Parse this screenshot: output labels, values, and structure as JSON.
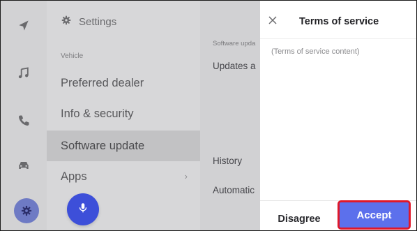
{
  "rail": {
    "icons": [
      "navigation-icon",
      "music-icon",
      "phone-icon",
      "car-icon",
      "settings-icon"
    ],
    "active": "settings-icon"
  },
  "settings": {
    "title": "Settings",
    "section": "Vehicle",
    "items": [
      {
        "label": "Preferred dealer"
      },
      {
        "label": "Info & security"
      },
      {
        "label": "Software update",
        "selected": true
      },
      {
        "label": "Apps",
        "chevron": "›"
      }
    ]
  },
  "detail": {
    "section_label": "Software upda",
    "updates_label": "Updates a",
    "history_label": "History",
    "automatic_label": "Automatic"
  },
  "dialog": {
    "title": "Terms of service",
    "content": "(Terms of service content)",
    "disagree_label": "Disagree",
    "accept_label": "Accept"
  },
  "colors": {
    "accent": "#5c70ec",
    "mic": "#3d4fd9",
    "highlight_border": "#e0182a"
  }
}
